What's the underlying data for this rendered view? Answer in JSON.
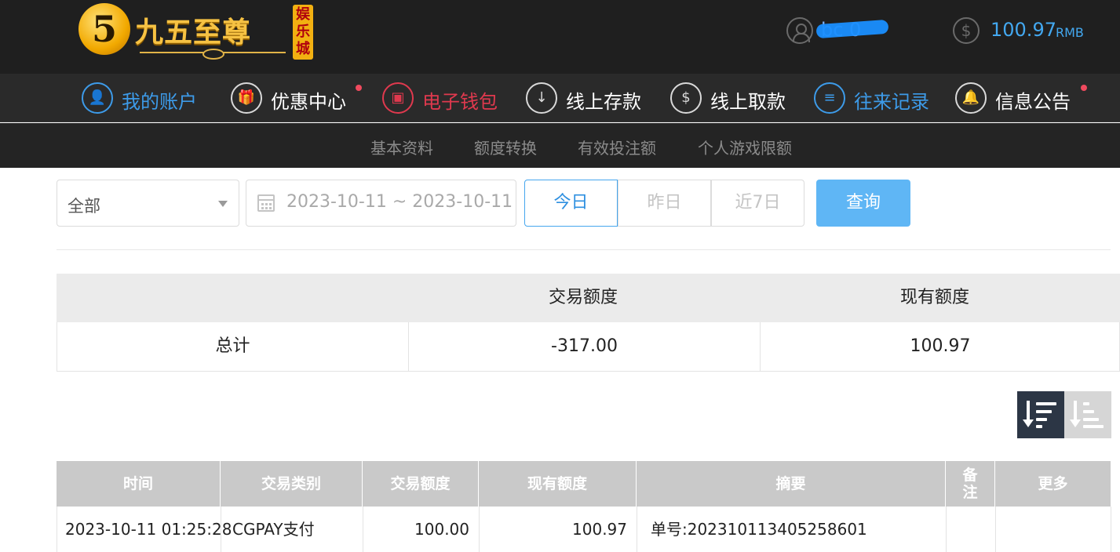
{
  "header": {
    "logo_text": "九五至尊",
    "logo_number": "5",
    "logo_tag": [
      "娱",
      "乐",
      "城"
    ],
    "username": "bc    0",
    "balance": "100.97",
    "currency": "RMB"
  },
  "main_nav": [
    {
      "label": "我的账户",
      "icon": "user-icon",
      "glyph": "👤",
      "style": "blue",
      "dot": false
    },
    {
      "label": "优惠中心",
      "icon": "gift-icon",
      "glyph": "🎁",
      "style": "normal",
      "dot": true
    },
    {
      "label": "电子钱包",
      "icon": "wallet-icon",
      "glyph": "▣",
      "style": "red",
      "dot": false
    },
    {
      "label": "线上存款",
      "icon": "deposit-icon",
      "glyph": "↓",
      "style": "normal",
      "dot": false
    },
    {
      "label": "线上取款",
      "icon": "withdraw-icon",
      "glyph": "$",
      "style": "normal",
      "dot": false
    },
    {
      "label": "往来记录",
      "icon": "records-icon",
      "glyph": "≡",
      "style": "blue",
      "dot": false
    },
    {
      "label": "信息公告",
      "icon": "bell-icon",
      "glyph": "🔔",
      "style": "normal",
      "dot": true
    }
  ],
  "sub_nav": [
    "基本资料",
    "额度转换",
    "有效投注额",
    "个人游戏限额"
  ],
  "filter": {
    "type_value": "全部",
    "date_range": "2023-10-11 ~ 2023-10-11",
    "quick": [
      "今日",
      "昨日",
      "近7日"
    ],
    "active_quick": 0,
    "query_label": "查询"
  },
  "summary": {
    "headers": [
      "",
      "交易额度",
      "现有额度"
    ],
    "row": [
      "总计",
      "-317.00",
      "100.97"
    ]
  },
  "records": {
    "headers": [
      "时间",
      "交易类别",
      "交易额度",
      "现有额度",
      "摘要",
      "备注",
      "更多"
    ],
    "rows": [
      [
        "2023-10-11 01:25:28",
        "CGPAY支付",
        "100.00",
        "100.97",
        "单号:20231011340525860​1",
        "",
        ""
      ]
    ]
  },
  "colors": {
    "accent_blue": "#3d9be9",
    "accent_red": "#e0394e",
    "query_button": "#5fb6f5",
    "header_bg": "#1f1f1f"
  }
}
